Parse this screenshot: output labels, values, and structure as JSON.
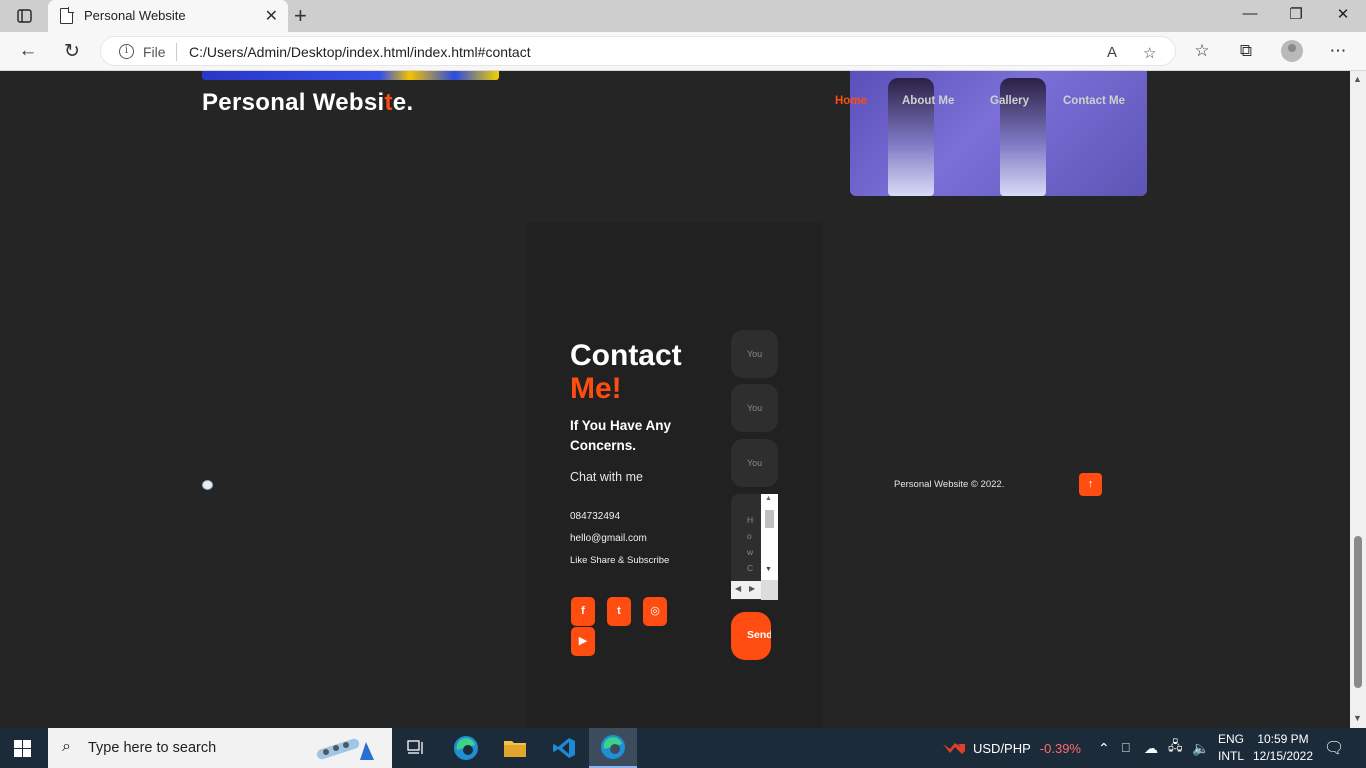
{
  "browser": {
    "tab_title": "Personal Website",
    "address_label": "File",
    "url": "C:/Users/Admin/Desktop/index.html/index.html#contact",
    "read_aloud_label": "A",
    "new_tab_symbol": "+",
    "close_symbol": "✕"
  },
  "site": {
    "brand_prefix": "Personal Websi",
    "brand_accent": "t",
    "brand_suffix": "e.",
    "nav": [
      "Home",
      "About Me",
      "Gallery",
      "Contact Me"
    ],
    "active_nav": "Home",
    "accent_color": "#ff4d11"
  },
  "contact": {
    "title_line1": "Contact",
    "title_line2": "Me!",
    "subtitle": "If You Have Any Concerns.",
    "chat_label": "Chat with me",
    "phone": "084732494",
    "email": "hello@gmail.com",
    "tagline": "Like Share & Subscribe",
    "fields": [
      {
        "placeholder": "You"
      },
      {
        "placeholder": "You"
      },
      {
        "placeholder": "You"
      }
    ],
    "message_placeholder": "HowCa",
    "send_label": "Send",
    "social": [
      {
        "name": "facebook-icon",
        "glyph": "f"
      },
      {
        "name": "twitter-icon",
        "glyph": "t"
      },
      {
        "name": "instagram-icon",
        "glyph": "◎"
      },
      {
        "name": "youtube-icon",
        "glyph": "▶"
      }
    ]
  },
  "footer": {
    "copyright": "Personal Website © 2022.",
    "back_to_top_glyph": "↑"
  },
  "taskbar": {
    "search_placeholder": "Type here to search",
    "currency_pair": "USD/PHP",
    "currency_change": "-0.39%",
    "lang_top": "ENG",
    "lang_bottom": "INTL",
    "time": "10:59 PM",
    "date": "12/15/2022"
  }
}
